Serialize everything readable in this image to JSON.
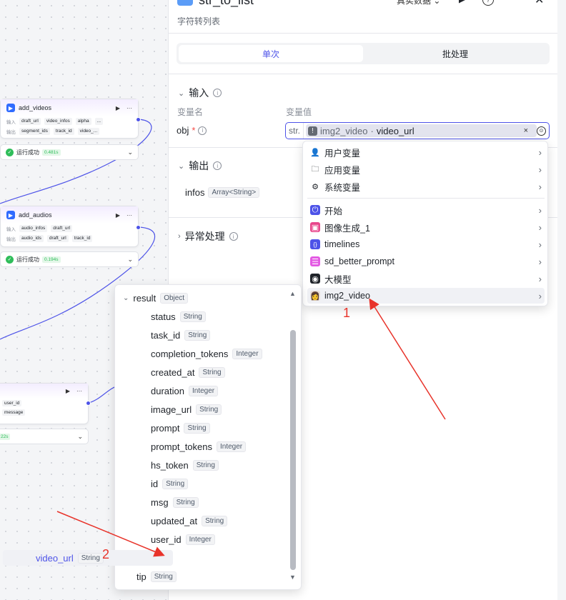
{
  "canvas": {
    "nodes": [
      {
        "title": "add_videos",
        "input_label": "输入",
        "output_label": "输出",
        "inputs": [
          "draft_url",
          "video_infos",
          "alpha",
          "..."
        ],
        "outputs": [
          "segment_ids",
          "track_id",
          "video_..."
        ],
        "status": "运行成功",
        "time": "0.481s"
      },
      {
        "title": "add_audios",
        "input_label": "输入",
        "output_label": "输出",
        "inputs": [
          "audio_infos",
          "draft_url"
        ],
        "outputs": [
          "audio_ids",
          "draft_url",
          "track_id"
        ],
        "status": "运行成功",
        "time": "0.194s"
      },
      {
        "inputs": [
          "user_id",
          "message"
        ],
        "time": "22s"
      }
    ]
  },
  "panel": {
    "title": "str_to_list",
    "real_data_label": "真实数据",
    "subtitle": "字符转列表",
    "tabs": [
      "单次",
      "批处理"
    ],
    "input_section": "输入",
    "col_name": "变量名",
    "col_value": "变量值",
    "obj_name": "obj",
    "req_mark": "*",
    "str_tag": "str.",
    "value_node": "img2_video",
    "value_sep": "·",
    "value_field": "video_url",
    "clear": "×",
    "output_section": "输出",
    "out_name": "infos",
    "out_type": "Array<String>",
    "error_section": "异常处理"
  },
  "menu": {
    "items": [
      {
        "label": "用户变量",
        "icon": "user-icon",
        "glyph": "👤",
        "color": "#1f2329"
      },
      {
        "label": "应用变量",
        "icon": "folder-icon",
        "glyph": "🗀",
        "color": "#1f2329"
      },
      {
        "label": "系统变量",
        "icon": "gear-icon",
        "glyph": "⚙",
        "color": "#1f2329"
      },
      {
        "label": "开始",
        "icon": "start-icon",
        "glyph": "⏻",
        "color": "#4d53e8"
      },
      {
        "label": "图像生成_1",
        "icon": "image-gen-icon",
        "glyph": "▣",
        "color": "#e8458b"
      },
      {
        "label": "timelines",
        "icon": "code-icon",
        "glyph": "{}",
        "color": "#4d53e8"
      },
      {
        "label": "sd_better_prompt",
        "icon": "prompt-icon",
        "glyph": "☰",
        "color": "#e35ae3"
      },
      {
        "label": "大模型",
        "icon": "llm-icon",
        "glyph": "◉",
        "color": "#1f2329"
      },
      {
        "label": "img2_video",
        "icon": "avatar-icon",
        "glyph": "👩",
        "color": "#8a6a58"
      }
    ],
    "arrow": "›"
  },
  "tree": {
    "root": {
      "name": "result",
      "type": "Object"
    },
    "children": [
      {
        "name": "status",
        "type": "String"
      },
      {
        "name": "task_id",
        "type": "String"
      },
      {
        "name": "completion_tokens",
        "type": "Integer"
      },
      {
        "name": "created_at",
        "type": "String"
      },
      {
        "name": "duration",
        "type": "Integer"
      },
      {
        "name": "image_url",
        "type": "String"
      },
      {
        "name": "prompt",
        "type": "String"
      },
      {
        "name": "prompt_tokens",
        "type": "Integer"
      },
      {
        "name": "hs_token",
        "type": "String"
      },
      {
        "name": "id",
        "type": "String"
      },
      {
        "name": "msg",
        "type": "String"
      },
      {
        "name": "updated_at",
        "type": "String"
      },
      {
        "name": "user_id",
        "type": "Integer"
      },
      {
        "name": "video_url",
        "type": "String"
      }
    ],
    "tail": {
      "name": "tip",
      "type": "String"
    }
  },
  "callouts": [
    "1",
    "2"
  ],
  "colors": {
    "accent": "#4d53e8",
    "annotation": "#e8332a",
    "success": "#2fbd5a"
  }
}
